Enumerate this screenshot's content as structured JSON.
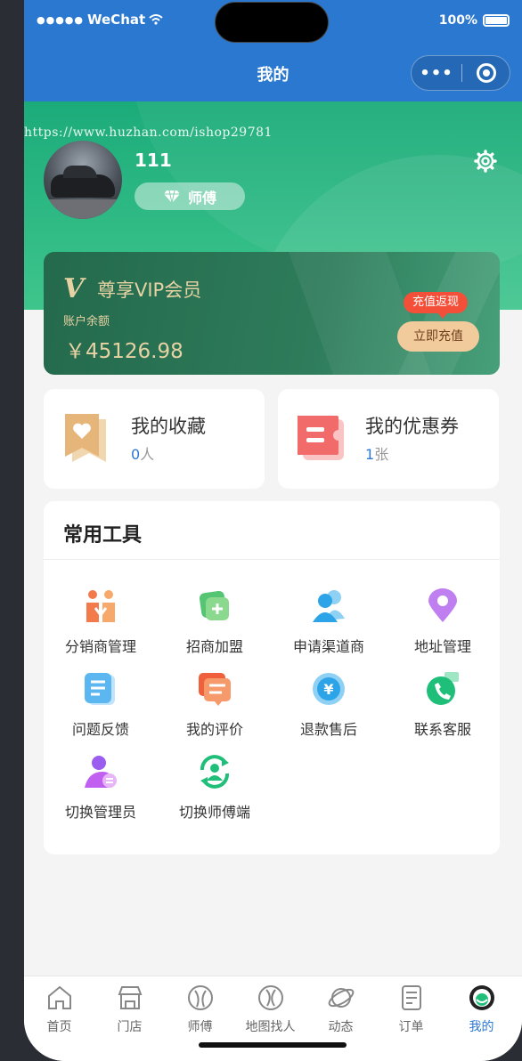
{
  "status": {
    "carrier": "WeChat",
    "battery": "100%"
  },
  "nav": {
    "title": "我的"
  },
  "watermark": "https://www.huzhan.com/ishop29781",
  "profile": {
    "name": "111",
    "role": "师傅"
  },
  "vip": {
    "logo": "V",
    "title": "尊享VIP会员",
    "balance_label": "账户余额",
    "balance": "￥45126.98",
    "promo_tag": "充值返现",
    "recharge_label": "立即充值"
  },
  "cards": [
    {
      "title": "我的收藏",
      "count": "0",
      "unit": "人",
      "icon": "bookmark-heart-icon"
    },
    {
      "title": "我的优惠券",
      "count": "1",
      "unit": "张",
      "icon": "coupon-icon"
    }
  ],
  "tools": {
    "title": "常用工具",
    "items": [
      {
        "label": "分销商管理",
        "icon": "distributor-icon"
      },
      {
        "label": "招商加盟",
        "icon": "franchise-icon"
      },
      {
        "label": "申请渠道商",
        "icon": "channel-apply-icon"
      },
      {
        "label": "地址管理",
        "icon": "location-pin-icon"
      },
      {
        "label": "问题反馈",
        "icon": "feedback-icon"
      },
      {
        "label": "我的评价",
        "icon": "review-icon"
      },
      {
        "label": "退款售后",
        "icon": "refund-icon"
      },
      {
        "label": "联系客服",
        "icon": "phone-service-icon"
      },
      {
        "label": "切换管理员",
        "icon": "switch-admin-icon"
      },
      {
        "label": "切换师傅端",
        "icon": "switch-master-icon"
      }
    ]
  },
  "tabs": [
    {
      "label": "首页",
      "icon": "home-icon"
    },
    {
      "label": "门店",
      "icon": "store-icon"
    },
    {
      "label": "师傅",
      "icon": "master-icon"
    },
    {
      "label": "地图找人",
      "icon": "map-icon"
    },
    {
      "label": "动态",
      "icon": "planet-icon"
    },
    {
      "label": "订单",
      "icon": "order-icon"
    },
    {
      "label": "我的",
      "icon": "mine-icon",
      "active": true
    }
  ],
  "colors": {
    "primary": "#2b78d0",
    "hero_green": "#1bab7a",
    "vip_gold": "#e7d2a3",
    "promo_red": "#f34f39"
  }
}
